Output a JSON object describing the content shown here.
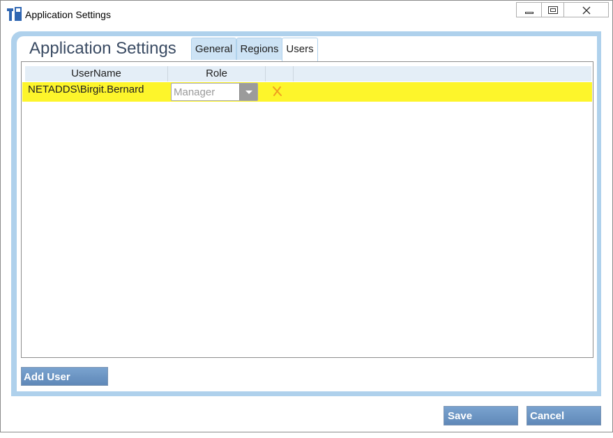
{
  "window": {
    "title": "Application Settings"
  },
  "page": {
    "heading": "Application Settings"
  },
  "tabs": [
    {
      "label": "General",
      "active": false
    },
    {
      "label": "Regions",
      "active": false
    },
    {
      "label": "Users",
      "active": true
    }
  ],
  "grid": {
    "columns": [
      "UserName",
      "Role",
      ""
    ],
    "rows": [
      {
        "username": "NETADDS\\Birgit.Bernard",
        "role": "Manager",
        "delete_icon": "close-x-icon",
        "highlight_color": "#fdf52b"
      }
    ]
  },
  "buttons": {
    "add_user": "Add User",
    "save": "Save",
    "cancel": "Cancel"
  },
  "colors": {
    "accent": "#afd1ec",
    "button": "#6a93c3",
    "heading": "#3a4b63",
    "delete": "#f0a020"
  },
  "icons": {
    "app": "app-logo-icon",
    "minimize": "minimize-icon",
    "maximize": "restore-icon",
    "close": "close-icon",
    "dropdown": "chevron-down-icon"
  }
}
